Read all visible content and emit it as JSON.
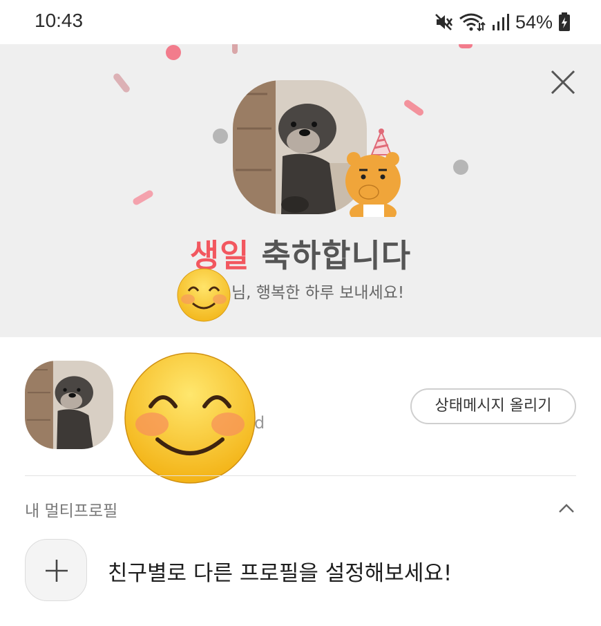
{
  "status_bar": {
    "time": "10:43",
    "battery_percent": "54%",
    "icons": [
      "mute-icon",
      "wifi-icon",
      "signal-icon",
      "battery-icon"
    ]
  },
  "birthday_banner": {
    "title_accent": "생일",
    "title_rest": "축하합니다",
    "subtitle": "님, 행복한 하루 보내세요!",
    "accent_color": "#f2575f",
    "background_color": "#efefef"
  },
  "profile": {
    "name_visible_tail": "d",
    "status_message_button": "상태메시지 올리기"
  },
  "multi_profile": {
    "section_label": "내 멀티프로필",
    "add_description": "친구별로 다른 프로필을 설정해보세요!"
  }
}
